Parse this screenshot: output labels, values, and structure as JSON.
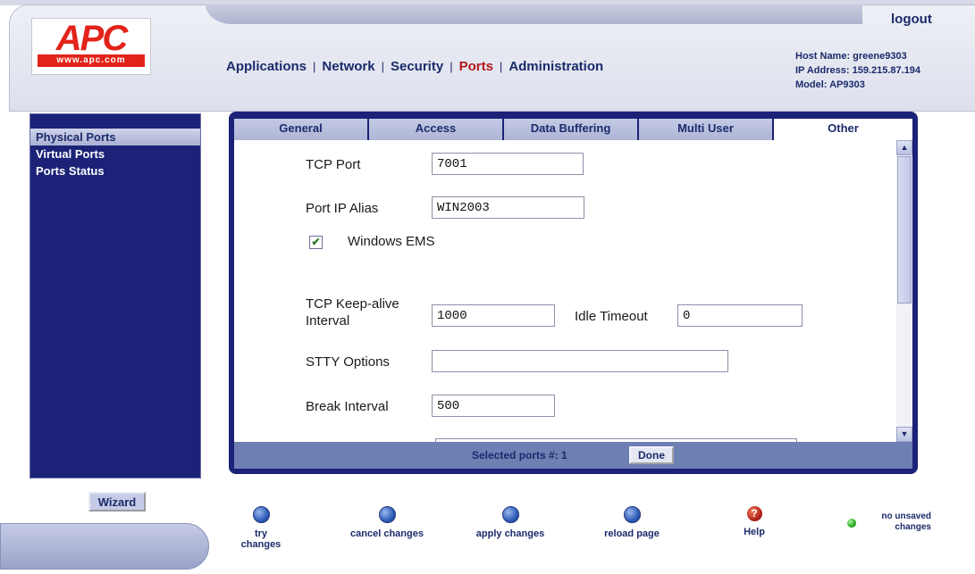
{
  "header": {
    "logo_text": "APC",
    "logo_url_text": "www.apc.com",
    "logout_label": "logout",
    "nav": [
      "Applications",
      "Network",
      "Security",
      "Ports",
      "Administration"
    ],
    "nav_active": "Ports",
    "host_name": "Host Name: greene9303",
    "ip_address": "IP Address: 159.215.87.194",
    "model": "Model: AP9303"
  },
  "sidebar": {
    "items": [
      {
        "label": "Physical Ports",
        "active": true
      },
      {
        "label": "Virtual Ports",
        "active": false
      },
      {
        "label": "Ports Status",
        "active": false
      }
    ],
    "wizard_label": "Wizard"
  },
  "tabs": [
    {
      "label": "General",
      "active": false
    },
    {
      "label": "Access",
      "active": false
    },
    {
      "label": "Data Buffering",
      "active": false
    },
    {
      "label": "Multi User",
      "active": false
    },
    {
      "label": "Other",
      "active": true
    }
  ],
  "form": {
    "tcp_port_label": "TCP Port",
    "tcp_port_value": "7001",
    "port_ip_alias_label": "Port IP Alias",
    "port_ip_alias_value": "WIN2003",
    "windows_ems_label": "Windows EMS",
    "windows_ems_checked": true,
    "tcp_keepalive_label_1": "TCP Keep-alive",
    "tcp_keepalive_label_2": "Interval",
    "tcp_keepalive_value": "1000",
    "idle_timeout_label": "Idle Timeout",
    "idle_timeout_value": "0",
    "stty_label": "STTY Options",
    "stty_value": "",
    "break_interval_label": "Break Interval",
    "break_interval_value": "500"
  },
  "footer": {
    "selected_ports": "Selected ports #: 1",
    "done_label": "Done"
  },
  "actions": [
    {
      "label": "try changes",
      "icon": "blue-dot-icon"
    },
    {
      "label": "cancel changes",
      "icon": "blue-dot-icon"
    },
    {
      "label": "apply changes",
      "icon": "blue-dot-icon"
    },
    {
      "label": "reload page",
      "icon": "blue-dot-icon"
    },
    {
      "label": "Help",
      "icon": "help-icon"
    }
  ],
  "status": {
    "line1": "no unsaved",
    "line2": "changes",
    "led_color": "#26a821"
  },
  "colors": {
    "navy": "#1b2277",
    "active_nav": "#b3161b",
    "brand_red": "#e2231a"
  }
}
